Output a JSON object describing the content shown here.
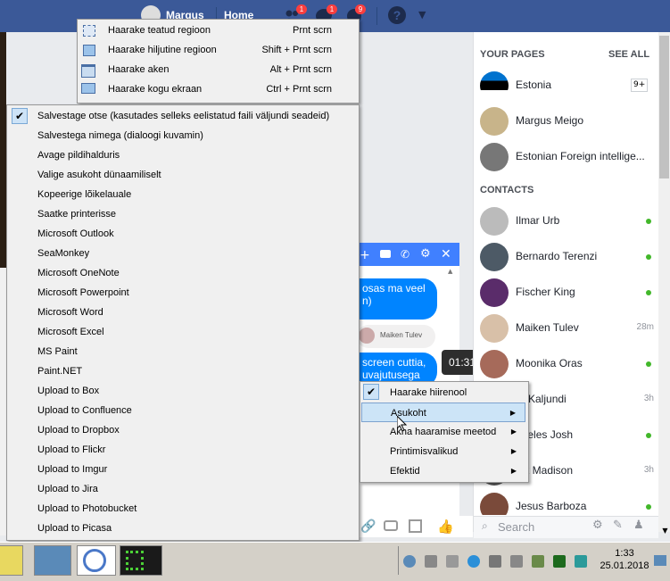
{
  "facebook": {
    "user_name": "Margus",
    "home_label": "Home",
    "friend_badge": "1",
    "messenger_badge": "1",
    "notifications_badge": "9",
    "help_icon": "question-icon",
    "chevron_icon": "chevron-down-icon"
  },
  "capture_menu": {
    "items": [
      {
        "label": "Haarake teatud regioon",
        "shortcut": "Prnt scrn",
        "icon": "region-icon"
      },
      {
        "label": "Haarake hiljutine regioon",
        "shortcut": "Shift + Prnt scrn",
        "icon": "last-region-icon"
      },
      {
        "label": "Haarake aken",
        "shortcut": "Alt + Prnt scrn",
        "icon": "window-icon"
      },
      {
        "label": "Haarake kogu ekraan",
        "shortcut": "Ctrl + Prnt scrn",
        "icon": "fullscreen-icon"
      }
    ]
  },
  "destination_menu": {
    "items": [
      "Salvestage otse (kasutades selleks eelistatud faili väljundi seadeid)",
      "Salvestega nimega (dialoogi kuvamin)",
      "Avage pildihalduris",
      "Valige asukoht dünaamiliselt",
      "Kopeerige lõikelauale",
      "Saatke printerisse",
      "Microsoft Outlook",
      "SeaMonkey",
      "Microsoft OneNote",
      "Microsoft Powerpoint",
      "Microsoft Word",
      "Microsoft Excel",
      "MS Paint",
      "Paint.NET",
      "Upload to Box",
      "Upload to Confluence",
      "Upload to Dropbox",
      "Upload to Flickr",
      "Upload to Imgur",
      "Upload to Jira",
      "Upload to Photobucket",
      "Upload to Picasa"
    ],
    "checked_index": 0
  },
  "submenu": {
    "items": [
      {
        "label": "Haarake hiirenool",
        "checked": true,
        "arrow": false
      },
      {
        "label": "Asukoht",
        "checked": false,
        "arrow": true,
        "highlighted": true
      },
      {
        "label": "Akna haaramise meetod",
        "checked": false,
        "arrow": true
      },
      {
        "label": "Printimisvalikud",
        "checked": false,
        "arrow": true
      },
      {
        "label": "Efektid",
        "checked": false,
        "arrow": true
      }
    ]
  },
  "chat": {
    "bubble1": "osas ma veel\nn)",
    "sender_name": "Maiken Tulev",
    "bubble2": "screen cuttia,\nuvajutusega",
    "tooltip_time": "01:31"
  },
  "sidebar": {
    "pages_header": "YOUR PAGES",
    "see_all": "SEE ALL",
    "pages": [
      {
        "name": "Estonia",
        "badge": "9+"
      },
      {
        "name": "Margus Meigo",
        "badge": ""
      },
      {
        "name": "Estonian Foreign intellige...",
        "badge": ""
      }
    ],
    "contacts_header": "CONTACTS",
    "contacts": [
      {
        "name": "Ilmar Urb",
        "status": "online",
        "time": ""
      },
      {
        "name": "Bernardo Terenzi",
        "status": "online",
        "time": ""
      },
      {
        "name": "Fischer King",
        "status": "online",
        "time": ""
      },
      {
        "name": "Maiken Tulev",
        "status": "away",
        "time": "28m"
      },
      {
        "name": "Moonika Oras",
        "status": "online",
        "time": ""
      },
      {
        "name": "ar Kaljundi",
        "status": "away",
        "time": "3h"
      },
      {
        "name": "ngeles Josh",
        "status": "online",
        "time": ""
      },
      {
        "name": "jak Madison",
        "status": "away",
        "time": "3h"
      },
      {
        "name": "Jesus Barboza",
        "status": "online",
        "time": ""
      }
    ],
    "search_placeholder": "Search"
  },
  "taskbar": {
    "time": "1:33",
    "date": "25.01.2018"
  },
  "colors": {
    "fb_blue": "#3b5998",
    "messenger_blue": "#0084ff",
    "online_green": "#42b72a",
    "menu_bg": "#f0f0f0",
    "menu_highlight": "#cce4f7"
  }
}
